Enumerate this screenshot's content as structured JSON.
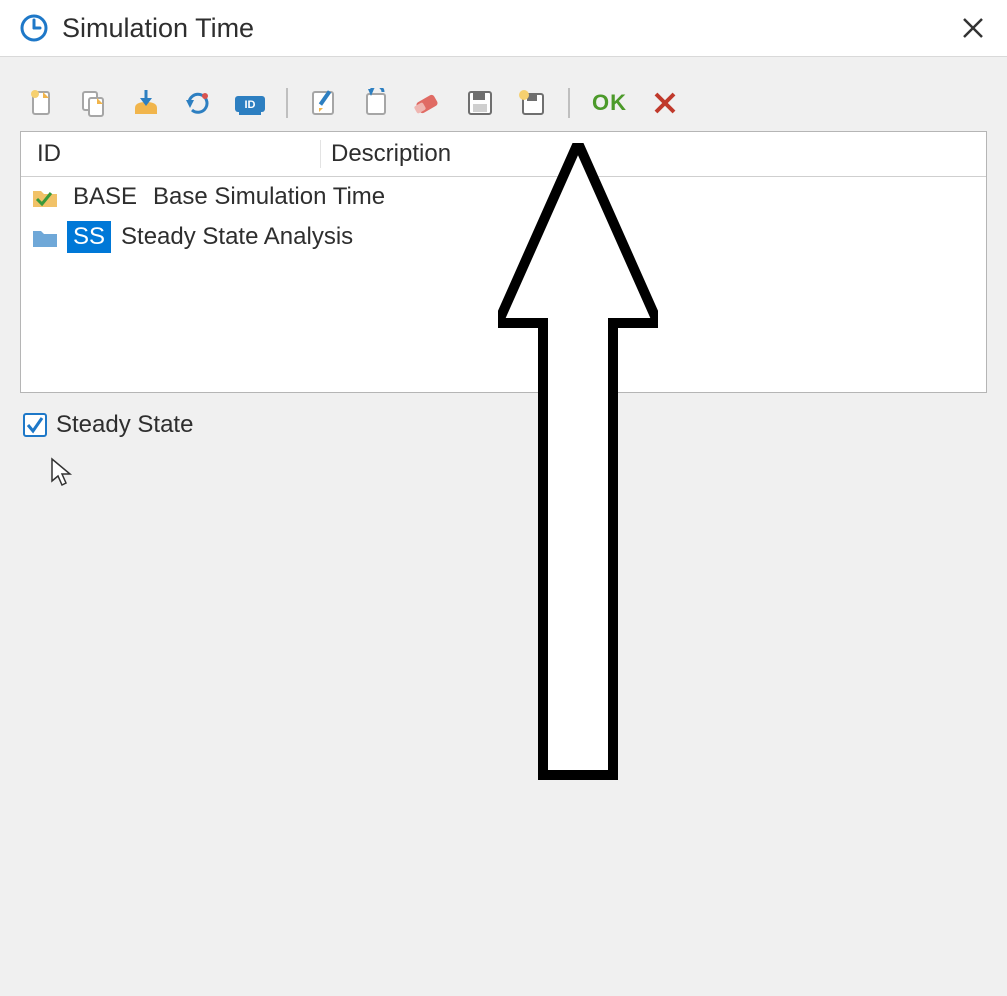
{
  "window": {
    "title": "Simulation Time"
  },
  "toolbar": {
    "ok_label": "OK"
  },
  "columns": {
    "id": "ID",
    "description": "Description"
  },
  "rows": [
    {
      "id": "BASE",
      "description": "Base Simulation Time",
      "selected": false
    },
    {
      "id": "SS",
      "description": "Steady State Analysis",
      "selected": true
    }
  ],
  "checkbox": {
    "steady_state_label": "Steady State",
    "steady_state_checked": true
  }
}
